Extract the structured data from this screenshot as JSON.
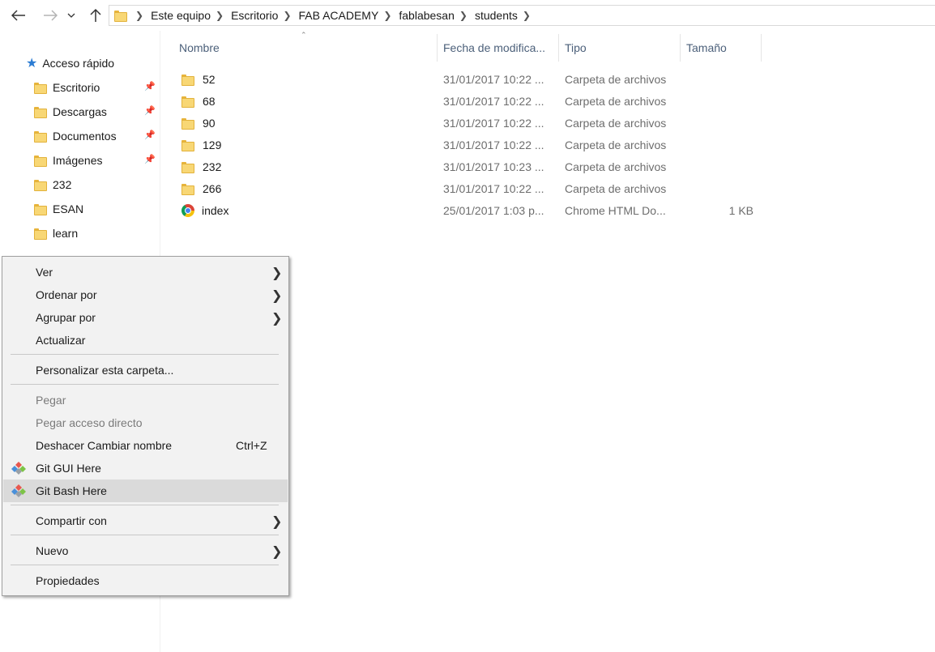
{
  "nav": {
    "back_icon": "back-arrow-icon",
    "forward_icon": "forward-arrow-icon",
    "recent_icon": "chevron-down-icon",
    "up_icon": "up-arrow-icon",
    "breadcrumbs": [
      "Este equipo",
      "Escritorio",
      "FAB ACADEMY",
      "fablabesan",
      "students"
    ]
  },
  "sidebar": {
    "quick_access": "Acceso rápido",
    "items": [
      {
        "label": "Escritorio",
        "pinned": true,
        "icon": "desktop-folder-icon"
      },
      {
        "label": "Descargas",
        "pinned": true,
        "icon": "downloads-folder-icon"
      },
      {
        "label": "Documentos",
        "pinned": true,
        "icon": "documents-folder-icon"
      },
      {
        "label": "Imágenes",
        "pinned": true,
        "icon": "pictures-folder-icon"
      },
      {
        "label": "232",
        "pinned": false,
        "icon": "folder-icon"
      },
      {
        "label": "ESAN",
        "pinned": false,
        "icon": "folder-icon"
      },
      {
        "label": "learn",
        "pinned": false,
        "icon": "folder-icon"
      }
    ]
  },
  "columns": {
    "name": "Nombre",
    "date": "Fecha de modifica...",
    "type": "Tipo",
    "size": "Tamaño"
  },
  "files": [
    {
      "name": "52",
      "date": "31/01/2017 10:22 ...",
      "type": "Carpeta de archivos",
      "size": "",
      "icon": "folder-icon"
    },
    {
      "name": "68",
      "date": "31/01/2017 10:22 ...",
      "type": "Carpeta de archivos",
      "size": "",
      "icon": "folder-icon"
    },
    {
      "name": "90",
      "date": "31/01/2017 10:22 ...",
      "type": "Carpeta de archivos",
      "size": "",
      "icon": "folder-icon"
    },
    {
      "name": "129",
      "date": "31/01/2017 10:22 ...",
      "type": "Carpeta de archivos",
      "size": "",
      "icon": "folder-icon"
    },
    {
      "name": "232",
      "date": "31/01/2017 10:23 ...",
      "type": "Carpeta de archivos",
      "size": "",
      "icon": "folder-icon"
    },
    {
      "name": "266",
      "date": "31/01/2017 10:22 ...",
      "type": "Carpeta de archivos",
      "size": "",
      "icon": "folder-icon"
    },
    {
      "name": "index",
      "date": "25/01/2017 1:03 p...",
      "type": "Chrome HTML Do...",
      "size": "1 KB",
      "icon": "chrome-icon"
    }
  ],
  "context_menu": {
    "ver": "Ver",
    "ordenar": "Ordenar por",
    "agrupar": "Agrupar por",
    "actualizar": "Actualizar",
    "personalizar": "Personalizar esta carpeta...",
    "pegar": "Pegar",
    "pegar_acceso": "Pegar acceso directo",
    "deshacer": "Deshacer Cambiar nombre",
    "deshacer_shortcut": "Ctrl+Z",
    "git_gui": "Git GUI Here",
    "git_bash": "Git Bash Here",
    "compartir": "Compartir con",
    "nuevo": "Nuevo",
    "propiedades": "Propiedades",
    "highlighted_item": "Git Bash Here"
  },
  "colors": {
    "accent": "#2b7cd3",
    "folder": "#f8d775",
    "menu_bg": "#f2f2f2",
    "menu_highlight": "#dadada",
    "header_text": "#4c607a"
  }
}
